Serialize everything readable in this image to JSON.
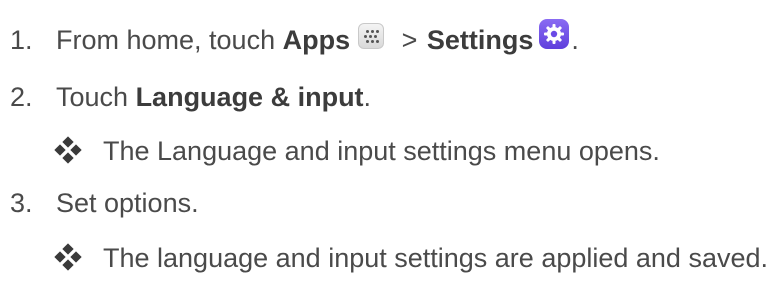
{
  "steps": [
    {
      "number": "1.",
      "text_before": "From home, touch ",
      "bold1": "Apps",
      "separator": " > ",
      "bold2": "Settings",
      "end": "."
    },
    {
      "number": "2.",
      "text_before": "Touch ",
      "bold1": "Language & input",
      "end": "."
    },
    {
      "number": "3.",
      "text": "Set options."
    }
  ],
  "results": [
    {
      "text": "The Language and input settings menu opens."
    },
    {
      "text": "The language and input settings are applied and saved."
    }
  ],
  "icons": {
    "apps": "apps-grid-icon",
    "settings": "settings-gear-icon",
    "bullet": "four-diamond-bullet-icon"
  },
  "colors": {
    "text": "#4a4a4a",
    "settings_icon": "#6a4ae6"
  }
}
